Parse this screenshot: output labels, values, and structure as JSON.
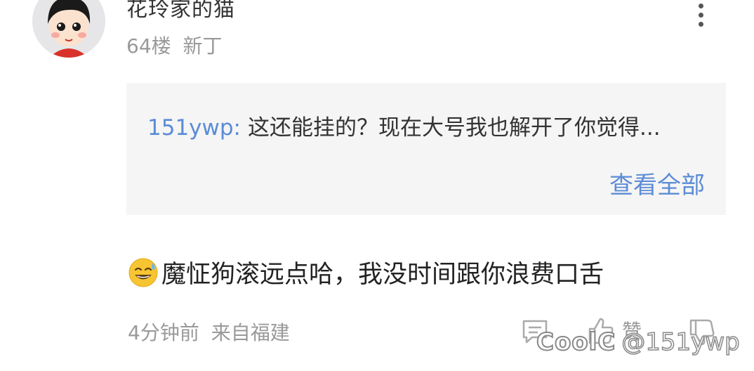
{
  "comment": {
    "username": "花玲家的猫",
    "floor": "64楼",
    "badge": "新丁",
    "quote": {
      "author": "151ywp",
      "separator": ":",
      "text": "这还能挂的？现在大号我也解开了你觉得...",
      "view_all": "查看全部"
    },
    "emoji": "sweat-smile-emoji",
    "reply_text": "魔怔狗滚远点哈，我没时间跟你浪费口舌",
    "time": "4分钟前",
    "location": "来自福建",
    "like_label": "赞"
  },
  "watermark": {
    "logo": "CoolC",
    "user": "@151ywp"
  },
  "colors": {
    "link": "#5b8cd6",
    "muted": "#999999",
    "quote_bg": "#f5f5f5"
  }
}
